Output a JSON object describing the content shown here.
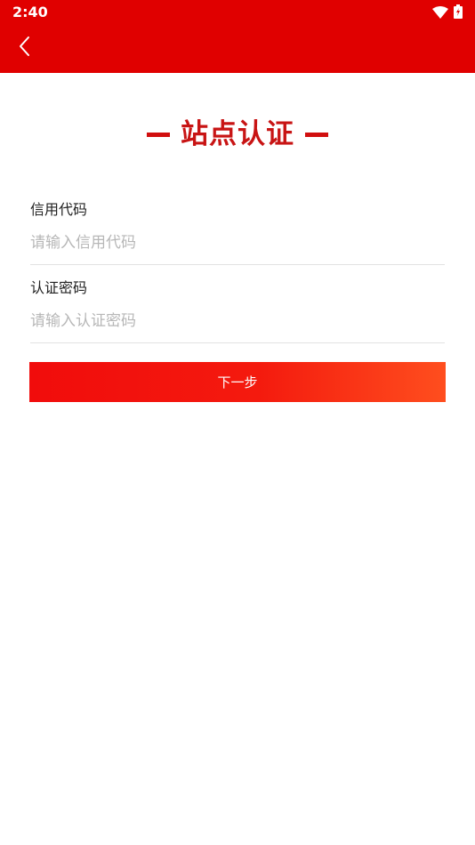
{
  "status_bar": {
    "time": "2:40",
    "icons": [
      "wifi-icon",
      "battery-charging-icon"
    ]
  },
  "nav": {
    "back_icon": "chevron-left-icon"
  },
  "page": {
    "title": "站点认证"
  },
  "form": {
    "credit_code": {
      "label": "信用代码",
      "placeholder": "请输入信用代码",
      "value": ""
    },
    "password": {
      "label": "认证密码",
      "placeholder": "请输入认证密码",
      "value": ""
    },
    "next_label": "下一步"
  },
  "colors": {
    "header": "#e00000",
    "title": "#c81414",
    "button_start": "#f10c0c",
    "button_end": "#ff4e1e"
  }
}
